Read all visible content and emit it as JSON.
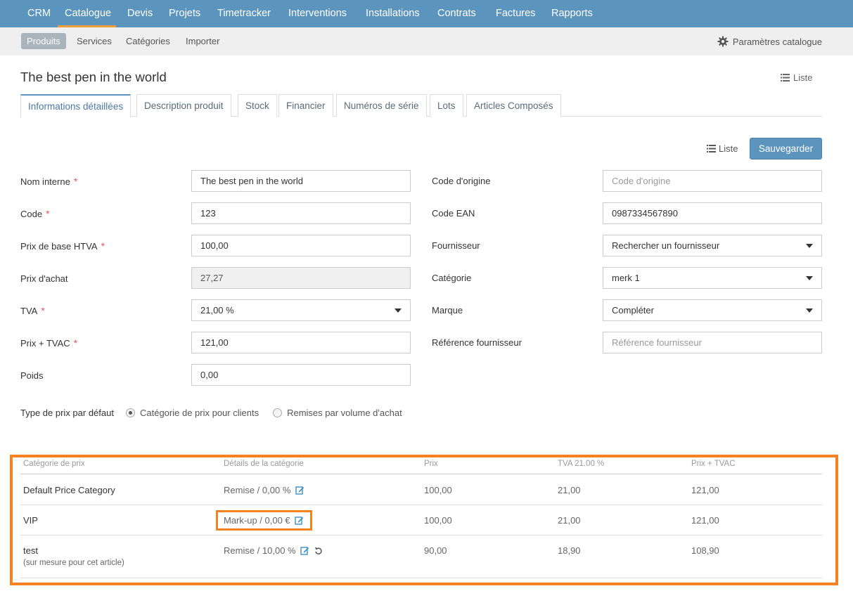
{
  "topnav": {
    "items": [
      "CRM",
      "Catalogue",
      "Devis",
      "Projets",
      "Timetracker",
      "Interventions",
      "Installations",
      "Contrats",
      "Factures",
      "Rapports"
    ],
    "active": "Catalogue"
  },
  "subnav": {
    "items": [
      "Produits",
      "Services",
      "Catégories",
      "Importer"
    ],
    "active": "Produits",
    "settings_label": "Paramètres catalogue",
    "settings_icon": "gear-icon"
  },
  "page": {
    "title": "The best pen in the world",
    "liste_label": "Liste"
  },
  "tabs": [
    "Informations détaillées",
    "Description produit",
    "Stock",
    "Financier",
    "Numéros de série",
    "Lots",
    "Articles Composés"
  ],
  "toolbar": {
    "liste_label": "Liste",
    "save_label": "Sauvegarder"
  },
  "form": {
    "left": [
      {
        "label": "Nom interne",
        "required": "*",
        "value": "The best pen in the world"
      },
      {
        "label": "Code",
        "required": "*",
        "value": "123"
      },
      {
        "label": "Prix de base HTVA",
        "required": "*",
        "value": "100,00"
      },
      {
        "label": "Prix d'achat",
        "required": "",
        "value": "27,27"
      },
      {
        "label": "TVA",
        "required": "*",
        "value": "21,00 %"
      },
      {
        "label": "Prix + TVAC",
        "required": "*",
        "value": "121,00"
      },
      {
        "label": "Poids",
        "required": "",
        "value": "0,00"
      }
    ],
    "right": [
      {
        "label": "Code d'origine",
        "placeholder": "Code d'origine"
      },
      {
        "label": "Code EAN",
        "value": "0987334567890"
      },
      {
        "label": "Fournisseur",
        "value": "Rechercher un fournisseur"
      },
      {
        "label": "Catégorie",
        "value": "merk 1"
      },
      {
        "label": "Marque",
        "value": "Compléter"
      },
      {
        "label": "Référence fournisseur",
        "placeholder": "Référence fournisseur"
      }
    ],
    "price_type": {
      "label": "Type de prix par défaut",
      "options": [
        "Catégorie de prix pour clients",
        "Remises par volume d'achat"
      ],
      "selected": "Catégorie de prix pour clients"
    }
  },
  "price_table": {
    "headers": [
      "Catégorie de prix",
      "Détails de la catégorie",
      "Prix",
      "TVA 21.00 %",
      "Prix + TVAC"
    ],
    "rows": [
      {
        "category": "Default Price Category",
        "details": "Remise / 0,00 %",
        "price": "100,00",
        "tva": "21,00",
        "total": "121,00",
        "note": ""
      },
      {
        "category": "VIP",
        "details": "Mark-up / 0,00 €",
        "price": "100,00",
        "tva": "21,00",
        "total": "121,00",
        "note": ""
      },
      {
        "category": "test",
        "details": "Remise / 10,00 %",
        "price": "90,00",
        "tva": "18,90",
        "total": "108,90",
        "note": "(sur mesure pour cet article)"
      }
    ]
  },
  "colors": {
    "nav": "#5b94bd",
    "accent": "#f39c34",
    "highlight": "#f5811f",
    "required": "#e05a5a"
  }
}
